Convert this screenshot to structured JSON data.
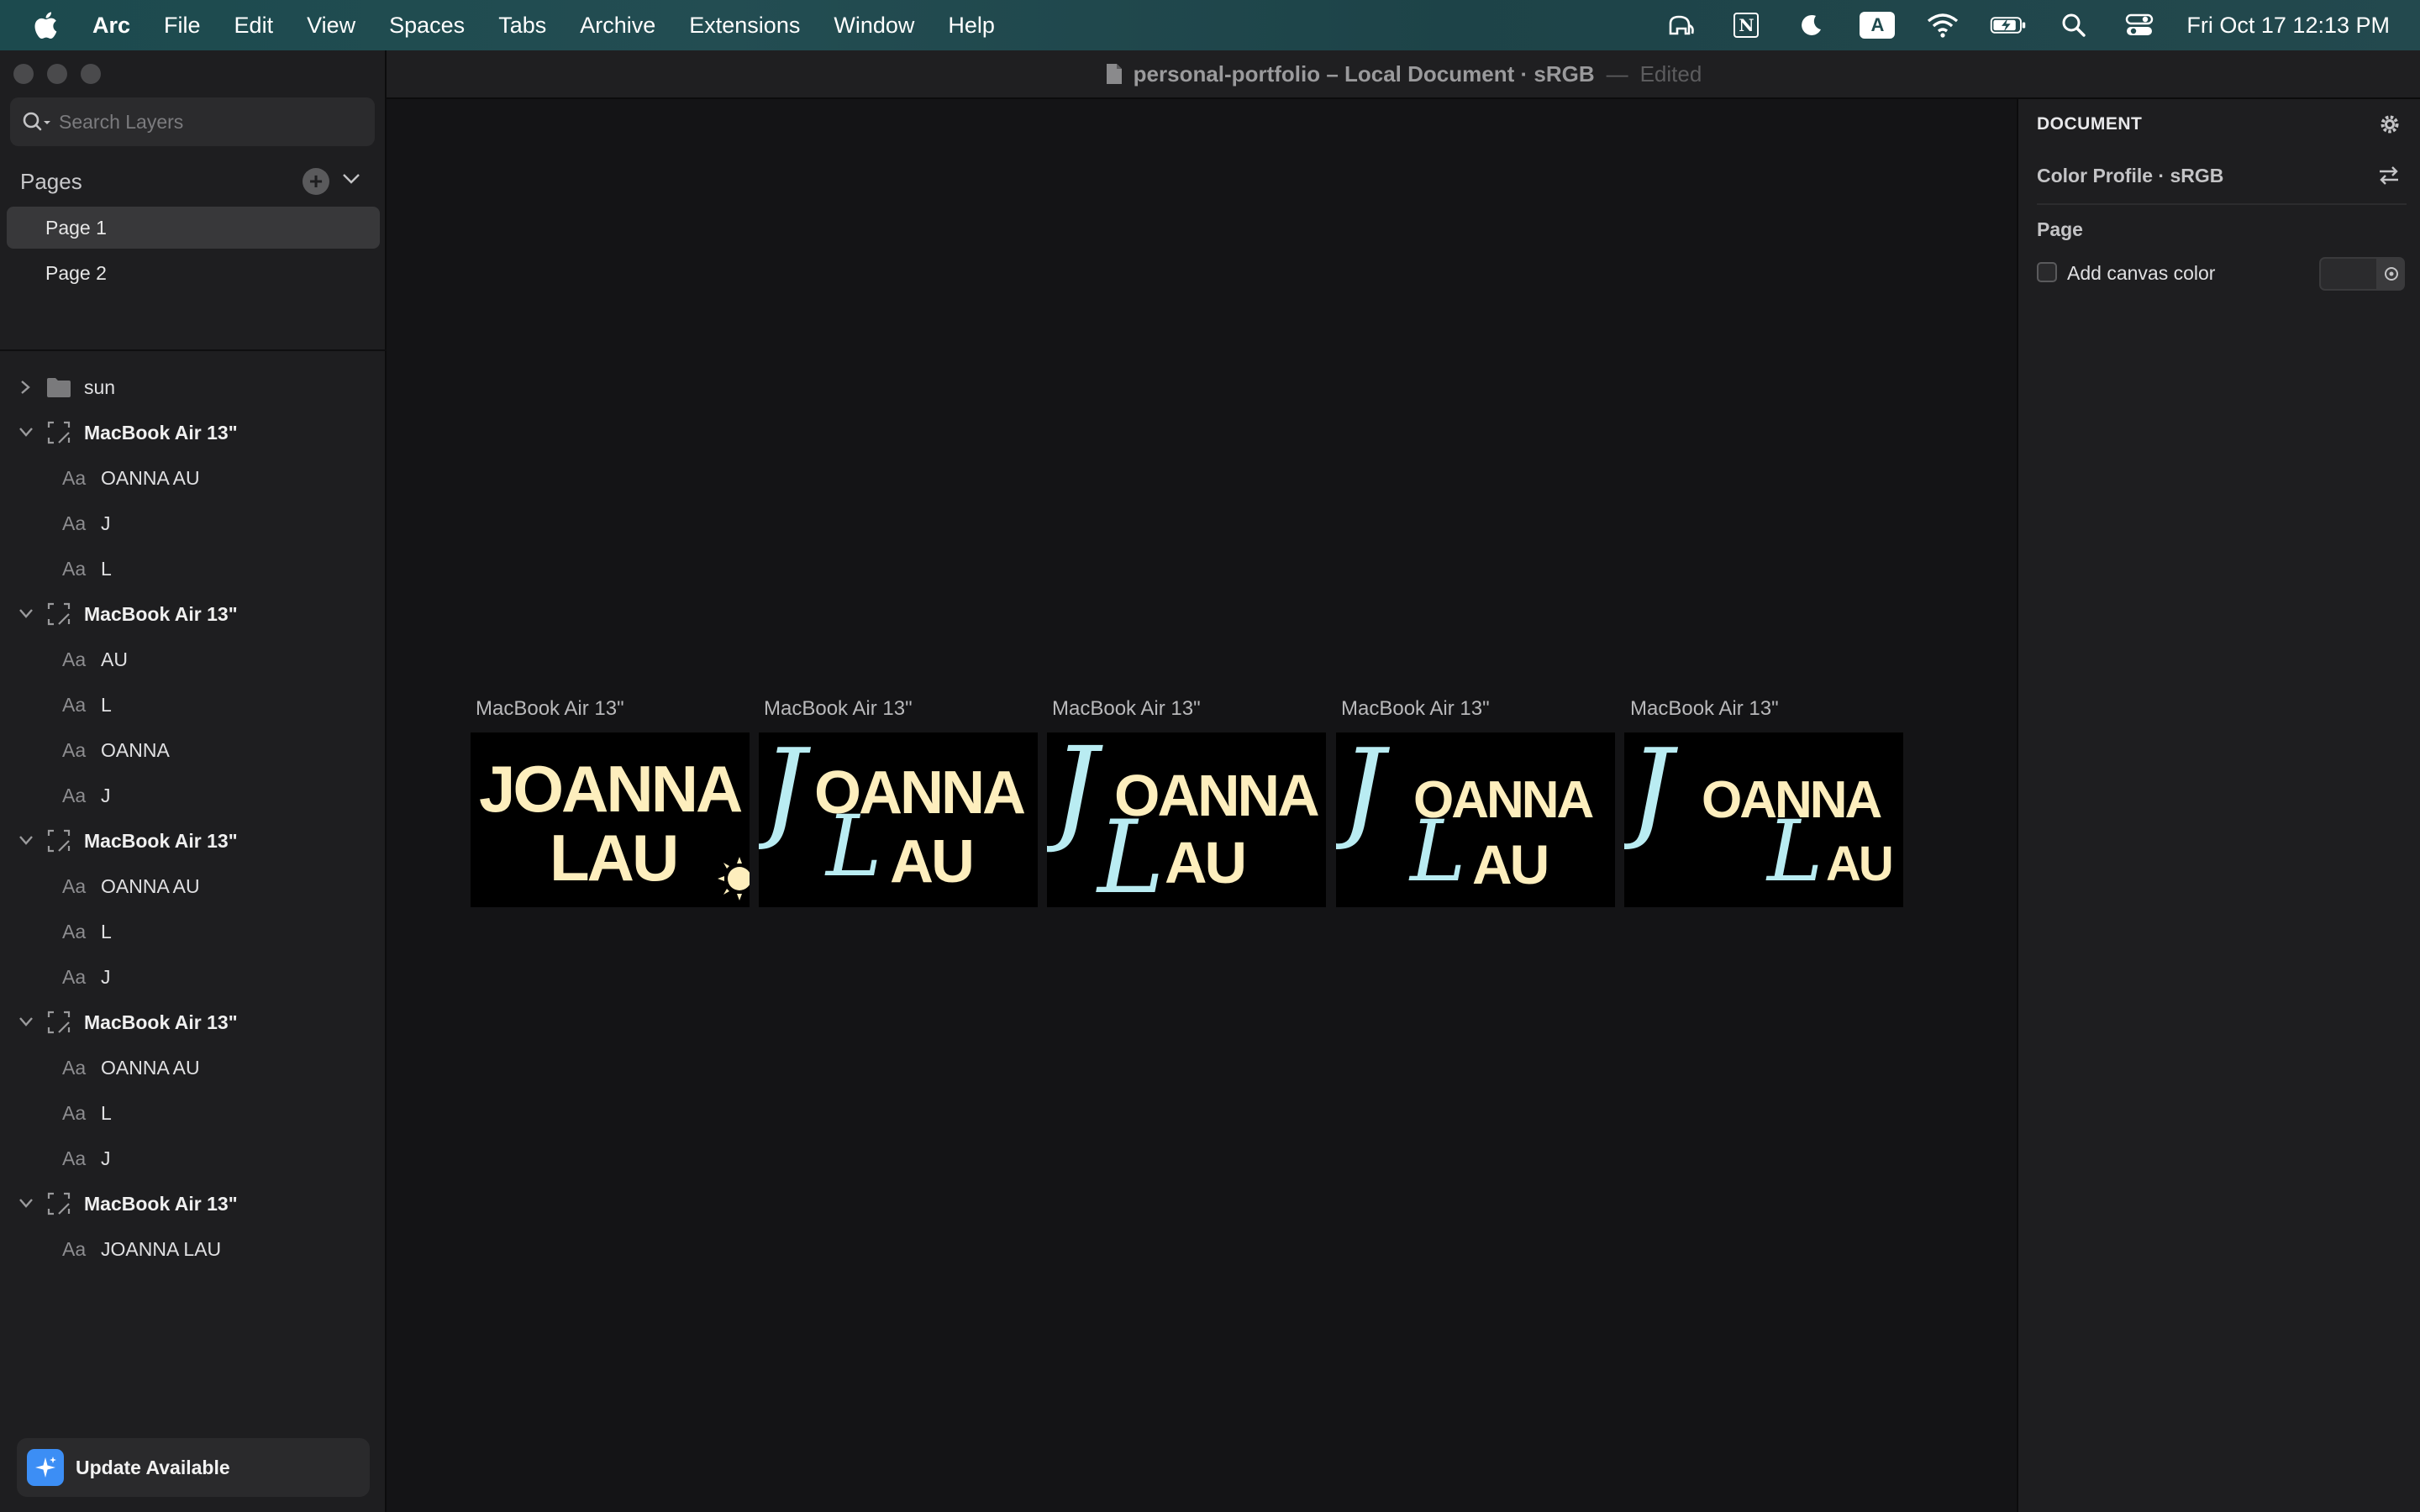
{
  "menubar": {
    "app_name": "Arc",
    "items": [
      "File",
      "Edit",
      "View",
      "Spaces",
      "Tabs",
      "Archive",
      "Extensions",
      "Window",
      "Help"
    ],
    "status_icons": [
      "elephant-icon",
      "notion-icon",
      "moon-icon",
      "input-source-icon",
      "wifi-icon",
      "battery-icon",
      "spotlight-icon",
      "control-center-icon"
    ],
    "input_source_letter": "A",
    "notion_letter": "N",
    "clock": "Fri Oct 17  12:13 PM"
  },
  "window": {
    "title": "personal-portfolio – Local Document · sRGB",
    "separator": "—",
    "edited": "Edited"
  },
  "sidebar": {
    "search_placeholder": "Search Layers",
    "pages_title": "Pages",
    "pages": [
      {
        "label": "Page 1",
        "active": true
      },
      {
        "label": "Page 2",
        "active": false
      }
    ],
    "layers": [
      {
        "type": "folder",
        "name": "sun",
        "collapsed": true
      },
      {
        "type": "artboard",
        "name": "MacBook Air 13\"",
        "children": [
          "OANNA AU",
          "J",
          "L"
        ]
      },
      {
        "type": "artboard",
        "name": "MacBook Air 13\"",
        "children": [
          "AU",
          "L",
          "OANNA",
          "J"
        ]
      },
      {
        "type": "artboard",
        "name": "MacBook Air 13\"",
        "children": [
          "OANNA AU",
          "L",
          "J"
        ]
      },
      {
        "type": "artboard",
        "name": "MacBook Air 13\"",
        "children": [
          "OANNA AU",
          "L",
          "J"
        ]
      },
      {
        "type": "artboard",
        "name": "MacBook Air 13\"",
        "children": [
          "JOANNA LAU"
        ]
      }
    ],
    "text_layer_prefix": "Aa",
    "update_label": "Update Available"
  },
  "canvas": {
    "artboards": [
      {
        "label": "MacBook Air 13\"",
        "line1": "JOANNA",
        "line2": "LAU",
        "style": "bold",
        "has_sun": true
      },
      {
        "label": "MacBook Air 13\"",
        "script1": "J",
        "rest1": "OANNA",
        "script2": "L",
        "rest2": "AU",
        "style": "script"
      },
      {
        "label": "MacBook Air 13\"",
        "script1": "J",
        "rest1": "OANNA",
        "script2": "L",
        "rest2": "AU",
        "style": "script"
      },
      {
        "label": "MacBook Air 13\"",
        "script1": "J",
        "rest1": "OANNA",
        "script2": "L",
        "rest2": "AU",
        "style": "script"
      },
      {
        "label": "MacBook Air 13\"",
        "script1": "J",
        "rest1": "OANNA",
        "script2": "L",
        "rest2": "AU",
        "style": "script"
      }
    ],
    "colors": {
      "cream": "#fdeebd",
      "script_cyan": "#b9ecf2",
      "artboard_bg": "#000000"
    }
  },
  "inspector": {
    "title": "DOCUMENT",
    "color_profile": "Color Profile · sRGB",
    "page_section": "Page",
    "canvas_color_label": "Add canvas color"
  }
}
